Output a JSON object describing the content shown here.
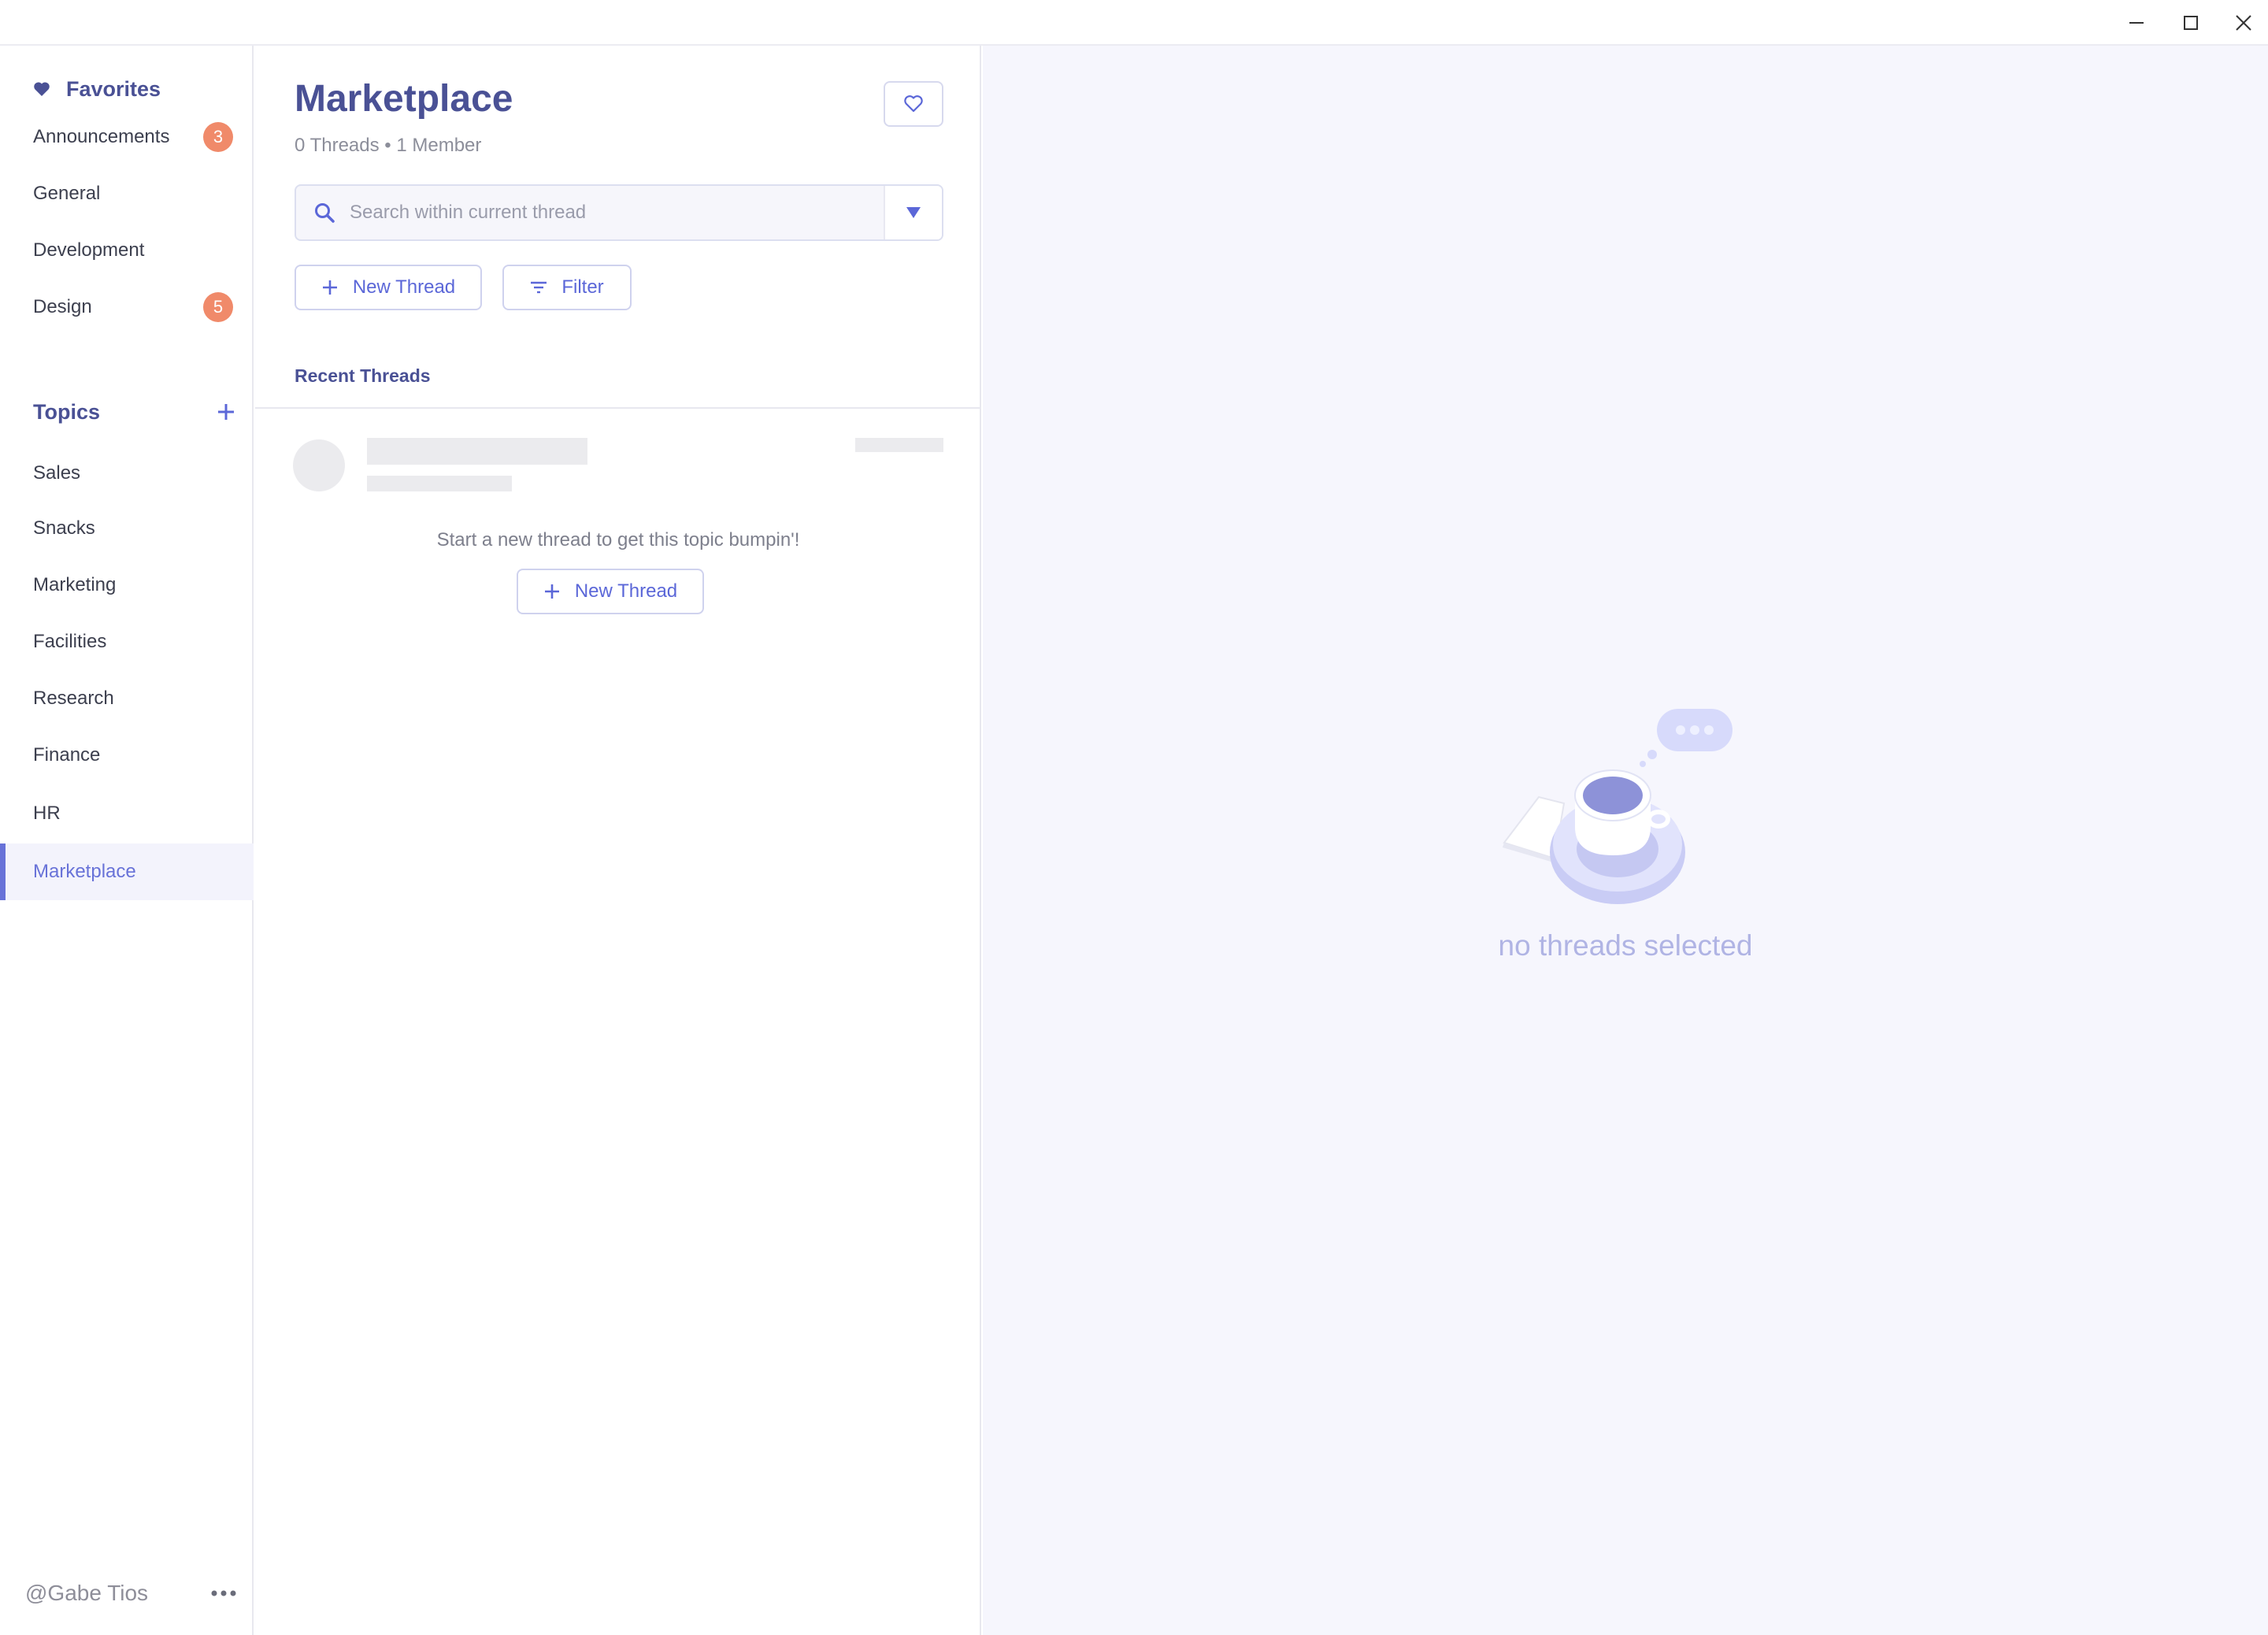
{
  "window": {
    "minimize_icon": "minimize-icon",
    "maximize_icon": "maximize-icon",
    "close_icon": "close-icon"
  },
  "sidebar": {
    "favorites_title": "Favorites",
    "favorites": [
      {
        "label": "Announcements",
        "badge": "3"
      },
      {
        "label": "General",
        "badge": ""
      },
      {
        "label": "Development",
        "badge": ""
      },
      {
        "label": "Design",
        "badge": "5"
      }
    ],
    "topics_title": "Topics",
    "topics": [
      {
        "label": "Sales"
      },
      {
        "label": "Snacks"
      },
      {
        "label": "Marketing"
      },
      {
        "label": "Facilities"
      },
      {
        "label": "Research"
      },
      {
        "label": "Finance"
      },
      {
        "label": "HR"
      },
      {
        "label": "Marketplace",
        "active": true
      }
    ],
    "username": "@Gabe Tios"
  },
  "main": {
    "title": "Marketplace",
    "meta": "0 Threads • 1 Member",
    "search_placeholder": "Search within current thread",
    "new_thread_label": "New Thread",
    "filter_label": "Filter",
    "recent_title": "Recent Threads",
    "empty_message": "Start a new thread to get this topic bumpin'!",
    "empty_button_label": "New Thread"
  },
  "detail": {
    "empty_text": "no threads selected"
  },
  "colors": {
    "accent": "#5b67d8",
    "heading": "#4a5195",
    "badge": "#f08a6a",
    "detail_bg": "#f6f6fd"
  }
}
